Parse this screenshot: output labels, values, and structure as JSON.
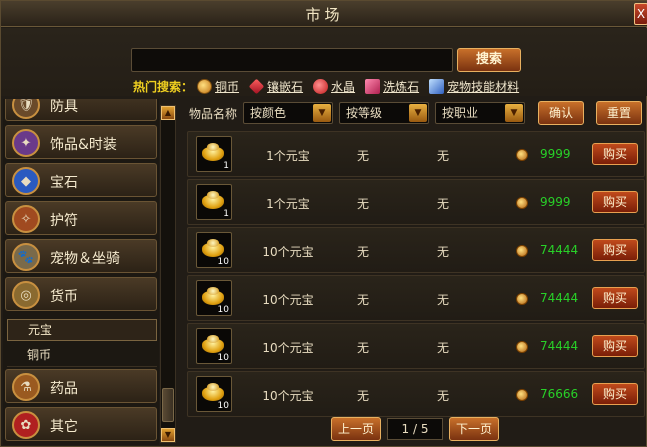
{
  "window": {
    "title": "市场",
    "close_label": "X"
  },
  "search": {
    "value": "",
    "button_label": "搜索",
    "hot_label": "热门搜索：",
    "hot_items": [
      "铜币",
      "镶嵌石",
      "水晶",
      "洗炼石",
      "宠物技能材料"
    ]
  },
  "sidebar": {
    "categories": [
      {
        "label": "防具",
        "icon": "armor-icon"
      },
      {
        "label": "饰品&时装",
        "icon": "accessory-icon"
      },
      {
        "label": "宝石",
        "icon": "gem-icon"
      },
      {
        "label": "护符",
        "icon": "talisman-icon"
      },
      {
        "label": "宠物＆坐骑",
        "icon": "pet-icon"
      },
      {
        "label": "货币",
        "icon": "currency-icon"
      },
      {
        "label": "药品",
        "icon": "medicine-icon"
      },
      {
        "label": "其它",
        "icon": "other-icon"
      }
    ],
    "subitems": [
      "元宝",
      "铜币"
    ],
    "selected_subitem": "元宝"
  },
  "filter": {
    "label": "物品名称",
    "color_select": "按颜色",
    "level_select": "按等级",
    "class_select": "按职业",
    "confirm_label": "确认",
    "reset_label": "重置"
  },
  "listings": [
    {
      "qty": "1",
      "name": "1个元宝",
      "col1": "无",
      "col2": "无",
      "price": "9999",
      "buy": "购买"
    },
    {
      "qty": "1",
      "name": "1个元宝",
      "col1": "无",
      "col2": "无",
      "price": "9999",
      "buy": "购买"
    },
    {
      "qty": "10",
      "name": "10个元宝",
      "col1": "无",
      "col2": "无",
      "price": "74444",
      "buy": "购买"
    },
    {
      "qty": "10",
      "name": "10个元宝",
      "col1": "无",
      "col2": "无",
      "price": "74444",
      "buy": "购买"
    },
    {
      "qty": "10",
      "name": "10个元宝",
      "col1": "无",
      "col2": "无",
      "price": "74444",
      "buy": "购买"
    },
    {
      "qty": "10",
      "name": "10个元宝",
      "col1": "无",
      "col2": "无",
      "price": "76666",
      "buy": "购买"
    }
  ],
  "pager": {
    "prev_label": "上一页",
    "page": "1 / 5",
    "next_label": "下一页"
  },
  "colors": {
    "price_green": "#28d028",
    "hot_yellow": "#f0d020",
    "button_orange": "#c8702a"
  }
}
